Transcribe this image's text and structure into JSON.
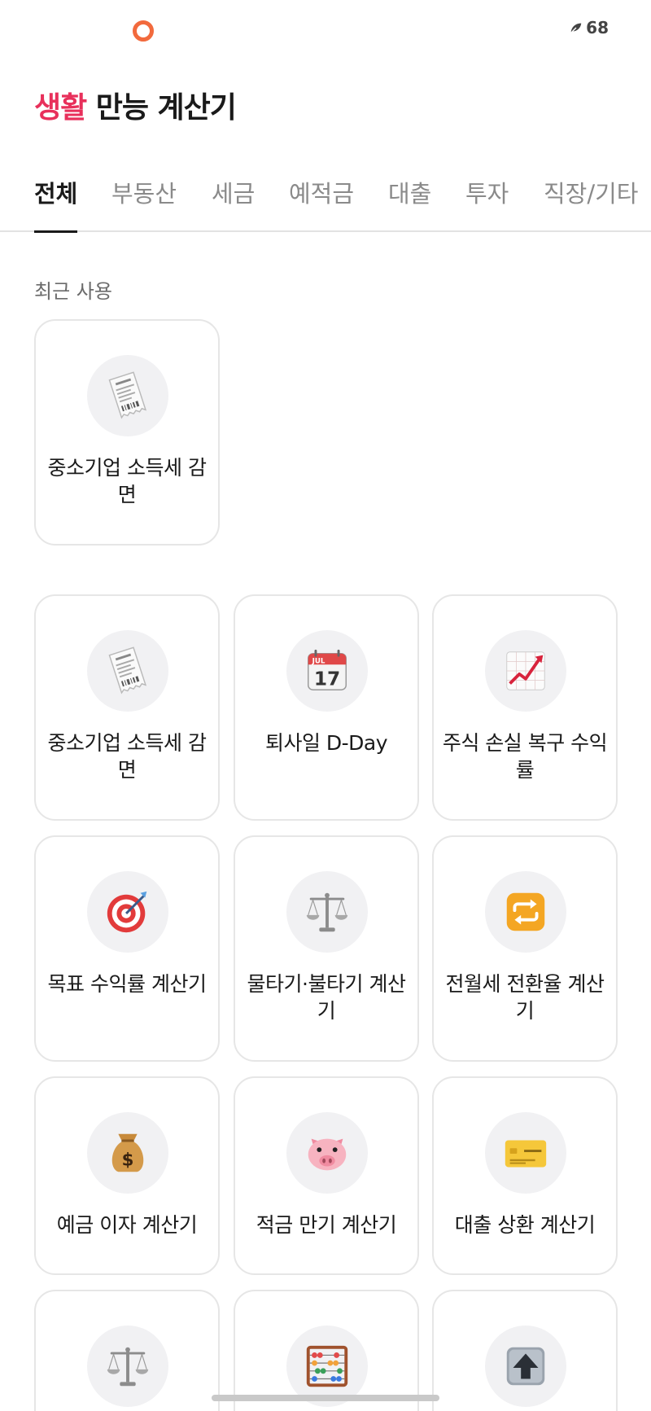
{
  "status_bar": {
    "battery_value": "68"
  },
  "header": {
    "title_accent": "생활",
    "title_rest": " 만능 계산기"
  },
  "tabs": [
    {
      "label": "전체",
      "active": true
    },
    {
      "label": "부동산"
    },
    {
      "label": "세금"
    },
    {
      "label": "예적금"
    },
    {
      "label": "대출"
    },
    {
      "label": "투자"
    },
    {
      "label": "직장/기타"
    }
  ],
  "recent": {
    "label": "최근 사용",
    "items": [
      {
        "label": "중소기업 소득세 감면",
        "icon": "receipt-icon"
      }
    ]
  },
  "calculators": [
    {
      "label": "중소기업 소득세 감면",
      "icon": "receipt-icon"
    },
    {
      "label": "퇴사일 D-Day",
      "icon": "calendar-icon",
      "calendar_month": "JUL",
      "calendar_day": "17"
    },
    {
      "label": "주식 손실 복구 수익률",
      "icon": "chart-up-icon"
    },
    {
      "label": "목표 수익률 계산기",
      "icon": "target-icon"
    },
    {
      "label": "물타기·불타기 계산기",
      "icon": "scales-icon"
    },
    {
      "label": "전월세 전환율 계산기",
      "icon": "repeat-icon"
    },
    {
      "label": "예금 이자 계산기",
      "icon": "money-bag-icon"
    },
    {
      "label": "적금 만기 계산기",
      "icon": "pig-icon"
    },
    {
      "label": "대출 상환 계산기",
      "icon": "credit-card-icon"
    },
    {
      "label": "",
      "icon": "scales-icon"
    },
    {
      "label": "",
      "icon": "abacus-icon"
    },
    {
      "label": "",
      "icon": "up-arrow-icon"
    }
  ],
  "colors": {
    "accent": "#e8305b",
    "status_ring": "#f26a3d"
  }
}
